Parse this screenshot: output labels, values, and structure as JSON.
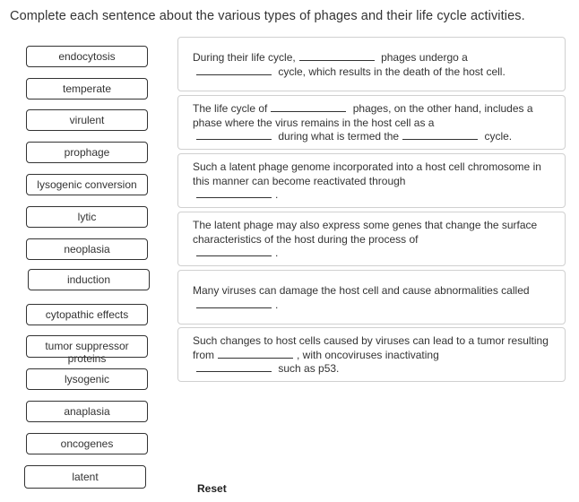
{
  "instructions": "Complete each sentence about the various types of phages and their life cycle activities.",
  "word_bank": [
    {
      "label": "endocytosis"
    },
    {
      "label": "temperate"
    },
    {
      "label": "virulent"
    },
    {
      "label": "prophage"
    },
    {
      "label": "lysogenic conversion"
    },
    {
      "label": "lytic"
    },
    {
      "label": "neoplasia"
    },
    {
      "label": "induction"
    },
    {
      "label": "cytopathic effects"
    },
    {
      "label": "tumor suppressor proteins"
    },
    {
      "label": "lysogenic"
    },
    {
      "label": "anaplasia"
    },
    {
      "label": "oncogenes"
    },
    {
      "label": "latent"
    }
  ],
  "sentences": [
    {
      "parts": [
        "During their life cycle,",
        "phages undergo a",
        "cycle, which results in the death of the host cell."
      ]
    },
    {
      "parts": [
        "The life cycle of",
        "phages, on the other hand, includes a phase where the virus remains in the host cell as a",
        "during what is termed the",
        "cycle."
      ]
    },
    {
      "parts": [
        "Such a latent phage genome incorporated into a host cell chromosome in this manner can become reactivated through",
        "."
      ]
    },
    {
      "parts": [
        "The latent phage may also express some genes that change the surface characteristics of the host during the process of",
        "."
      ]
    },
    {
      "parts": [
        "Many viruses can damage the host cell and cause abnormalities called",
        "."
      ]
    },
    {
      "parts": [
        "Such changes to host cells caused by viruses can lead to a tumor resulting from",
        ", with oncoviruses inactivating",
        "such as p53."
      ]
    }
  ],
  "reset_label": "Reset"
}
